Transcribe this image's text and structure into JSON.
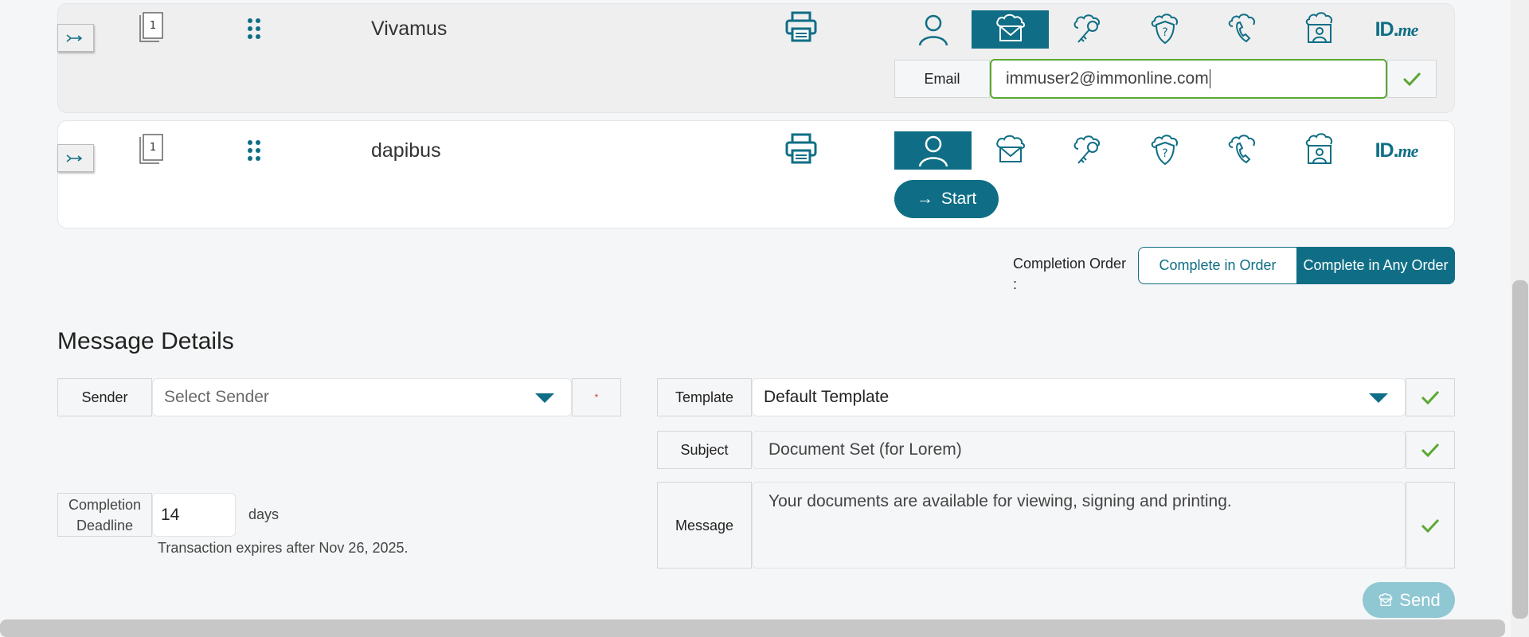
{
  "recipients": [
    {
      "name": "Vivamus",
      "active_method": "email",
      "email_label": "Email",
      "email_value": "immuser2@immonline.com"
    },
    {
      "name": "dapibus",
      "active_method": "in-person",
      "start_label": "Start",
      "start_arrow": "→"
    }
  ],
  "page_count_badge": "1",
  "idme": {
    "id": "ID.",
    "me": "me"
  },
  "completion_order": {
    "label": "Completion Order",
    "colon": ":",
    "options": [
      "Complete in Order",
      "Complete in Any Order"
    ],
    "selected": "Complete in Any Order"
  },
  "message_details": {
    "title": "Message Details",
    "sender_label": "Sender",
    "sender_placeholder": "Select Sender",
    "required_mark": "*",
    "template_label": "Template",
    "template_value": "Default Template",
    "subject_label": "Subject",
    "subject_value": "Document Set (for Lorem)",
    "message_label": "Message",
    "message_value": "Your documents are available for viewing, signing and printing.",
    "deadline_label_1": "Completion",
    "deadline_label_2": "Deadline",
    "deadline_value": "14",
    "deadline_unit": "days",
    "expires_note": "Transaction expires after Nov 26, 2025."
  },
  "send_label": "Send",
  "colors": {
    "accent": "#0f6e85",
    "check": "#5aa832",
    "send_disabled": "#8fc7d3"
  }
}
